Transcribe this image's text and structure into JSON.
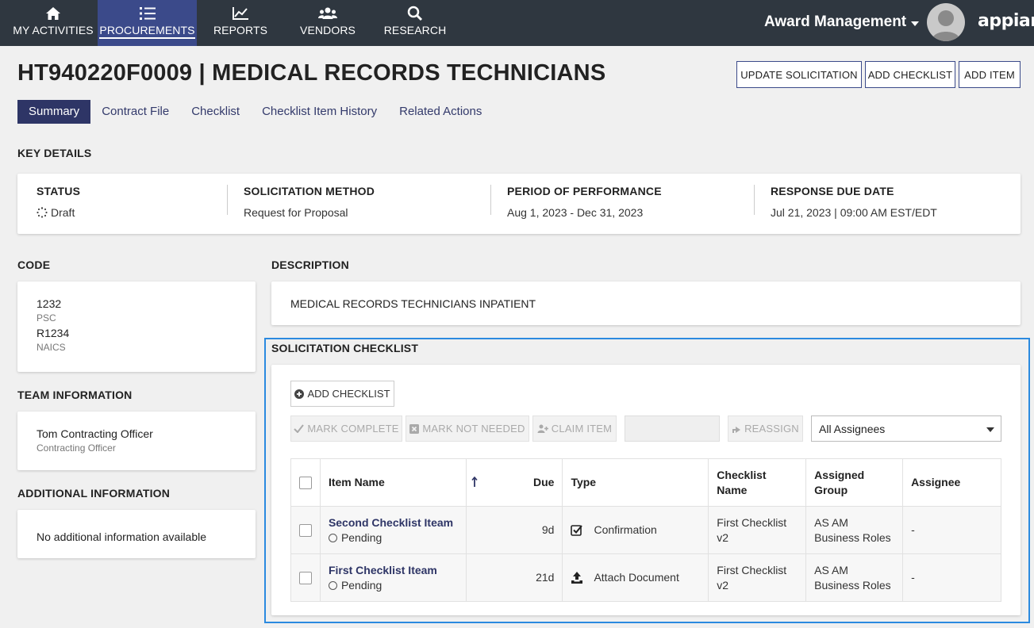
{
  "nav": {
    "items": [
      {
        "label": "MY ACTIVITIES",
        "icon": "home-icon"
      },
      {
        "label": "PROCUREMENTS",
        "icon": "list-icon"
      },
      {
        "label": "REPORTS",
        "icon": "chart-icon"
      },
      {
        "label": "VENDORS",
        "icon": "users-icon"
      },
      {
        "label": "RESEARCH",
        "icon": "search-icon"
      }
    ],
    "active": "PROCUREMENTS",
    "app_name": "Award Management",
    "brand": "appian"
  },
  "header": {
    "title": "HT940220F0009 | MEDICAL RECORDS TECHNICIANS",
    "buttons": {
      "update": "UPDATE SOLICITATION",
      "add_checklist": "ADD CHECKLIST",
      "add_item": "ADD ITEM"
    }
  },
  "tabs": [
    "Summary",
    "Contract File",
    "Checklist",
    "Checklist Item History",
    "Related Actions"
  ],
  "key_details": {
    "label": "KEY DETAILS",
    "status": {
      "heading": "STATUS",
      "value": "Draft"
    },
    "method": {
      "heading": "SOLICITATION METHOD",
      "value": "Request for Proposal"
    },
    "period": {
      "heading": "PERIOD OF PERFORMANCE",
      "value": "Aug 1, 2023 - Dec 31, 2023"
    },
    "due": {
      "heading": "RESPONSE DUE DATE",
      "value": "Jul 21, 2023 | 09:00 AM EST/EDT"
    }
  },
  "code": {
    "label": "CODE",
    "psc_value": "1232",
    "psc_label": "PSC",
    "naics_value": "R1234",
    "naics_label": "NAICS"
  },
  "description": {
    "label": "DESCRIPTION",
    "text": "MEDICAL RECORDS TECHNICIANS INPATIENT"
  },
  "team": {
    "label": "TEAM INFORMATION",
    "name": "Tom Contracting Officer",
    "role": "Contracting Officer"
  },
  "additional": {
    "label": "ADDITIONAL INFORMATION",
    "text": "No additional information available"
  },
  "checklist": {
    "label": "SOLICITATION CHECKLIST",
    "add_button": "ADD CHECKLIST",
    "toolbar": {
      "mark_complete": "MARK COMPLETE",
      "mark_not_needed": "MARK NOT NEEDED",
      "claim_item": "CLAIM ITEM",
      "reassign": "REASSIGN",
      "assignee_filter": "All Assignees"
    },
    "columns": {
      "item_name": "Item Name",
      "due": "Due",
      "type": "Type",
      "checklist_name_1": "Checklist",
      "checklist_name_2": "Name",
      "assigned_group_1": "Assigned",
      "assigned_group_2": "Group",
      "assignee": "Assignee"
    },
    "rows": [
      {
        "name": "Second Checklist Iteam",
        "status": "Pending",
        "due": "9d",
        "type": "Confirmation",
        "type_icon": "checkbox-checked-icon",
        "checklist_1": "First Checklist",
        "checklist_2": "v2",
        "group_1": "AS AM",
        "group_2": "Business Roles",
        "assignee": "-"
      },
      {
        "name": "First Checklist Iteam",
        "status": "Pending",
        "due": "21d",
        "type": "Attach Document",
        "type_icon": "upload-icon",
        "checklist_1": "First Checklist",
        "checklist_2": "v2",
        "group_1": "AS AM",
        "group_2": "Business Roles",
        "assignee": "-"
      }
    ]
  },
  "colors": {
    "topbar": "#2f3740",
    "active_nav": "#3b4a8a",
    "active_tab": "#2e3566",
    "focus_border": "#2b8ae0"
  }
}
